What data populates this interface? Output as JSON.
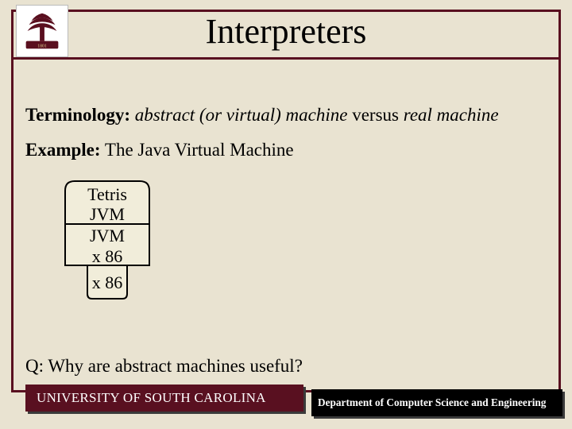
{
  "title": "Interpreters",
  "terminology": {
    "label": "Terminology:",
    "ital1": "abstract (or virtual) machine",
    "mid": " versus ",
    "ital2": "real machine"
  },
  "example": {
    "label": "Example:",
    "text": " The Java Virtual Machine"
  },
  "stack": {
    "l1": "Tetris",
    "l2": "JVM",
    "l3": "JVM",
    "l4": "x 86",
    "l5": "x 86"
  },
  "question": "Q: Why are abstract machines useful?",
  "footer": {
    "left": "UNIVERSITY OF SOUTH CAROLINA",
    "right": "Department of Computer Science and Engineering"
  }
}
